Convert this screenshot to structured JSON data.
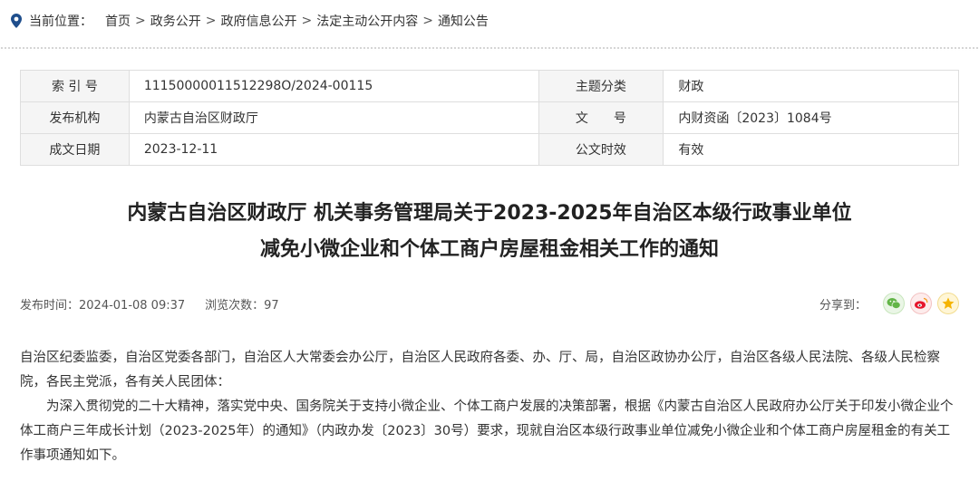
{
  "breadcrumb": {
    "label": "当前位置：",
    "items": [
      "首页",
      "政务公开",
      "政府信息公开",
      "法定主动公开内容",
      "通知公告"
    ],
    "separator": ">"
  },
  "meta": {
    "index_label": "索 引 号",
    "index_value": "11150000011512298O/2024-00115",
    "topic_label": "主题分类",
    "topic_value": "财政",
    "org_label": "发布机构",
    "org_value": "内蒙古自治区财政厅",
    "doc_no_label": "文　　号",
    "doc_no_value": "内财资函〔2023〕1084号",
    "date_label": "成文日期",
    "date_value": "2023-12-11",
    "effect_label": "公文时效",
    "effect_value": "有效"
  },
  "article": {
    "title_line1": "内蒙古自治区财政厅 机关事务管理局关于2023-2025年自治区本级行政事业单位",
    "title_line2": "减免小微企业和个体工商户房屋租金相关工作的通知",
    "publish_time": "发布时间：2024-01-08 09:37",
    "views": "浏览次数：97",
    "share_label": "分享到：",
    "paragraph1": "自治区纪委监委，自治区党委各部门，自治区人大常委会办公厅，自治区人民政府各委、办、厅、局，自治区政协办公厅，自治区各级人民法院、各级人民检察院，各民主党派，各有关人民团体：",
    "paragraph2": "为深入贯彻党的二十大精神，落实党中央、国务院关于支持小微企业、个体工商户发展的决策部署，根据《内蒙古自治区人民政府办公厅关于印发小微企业个体工商户三年成长计划（2023-2025年）的通知》（内政办发〔2023〕30号）要求，现就自治区本级行政事业单位减免小微企业和个体工商户房屋租金的有关工作事项通知如下。"
  },
  "colors": {
    "pin": "#1f4e8c",
    "label_bg": "#f5f5f5",
    "border": "#dedede"
  }
}
